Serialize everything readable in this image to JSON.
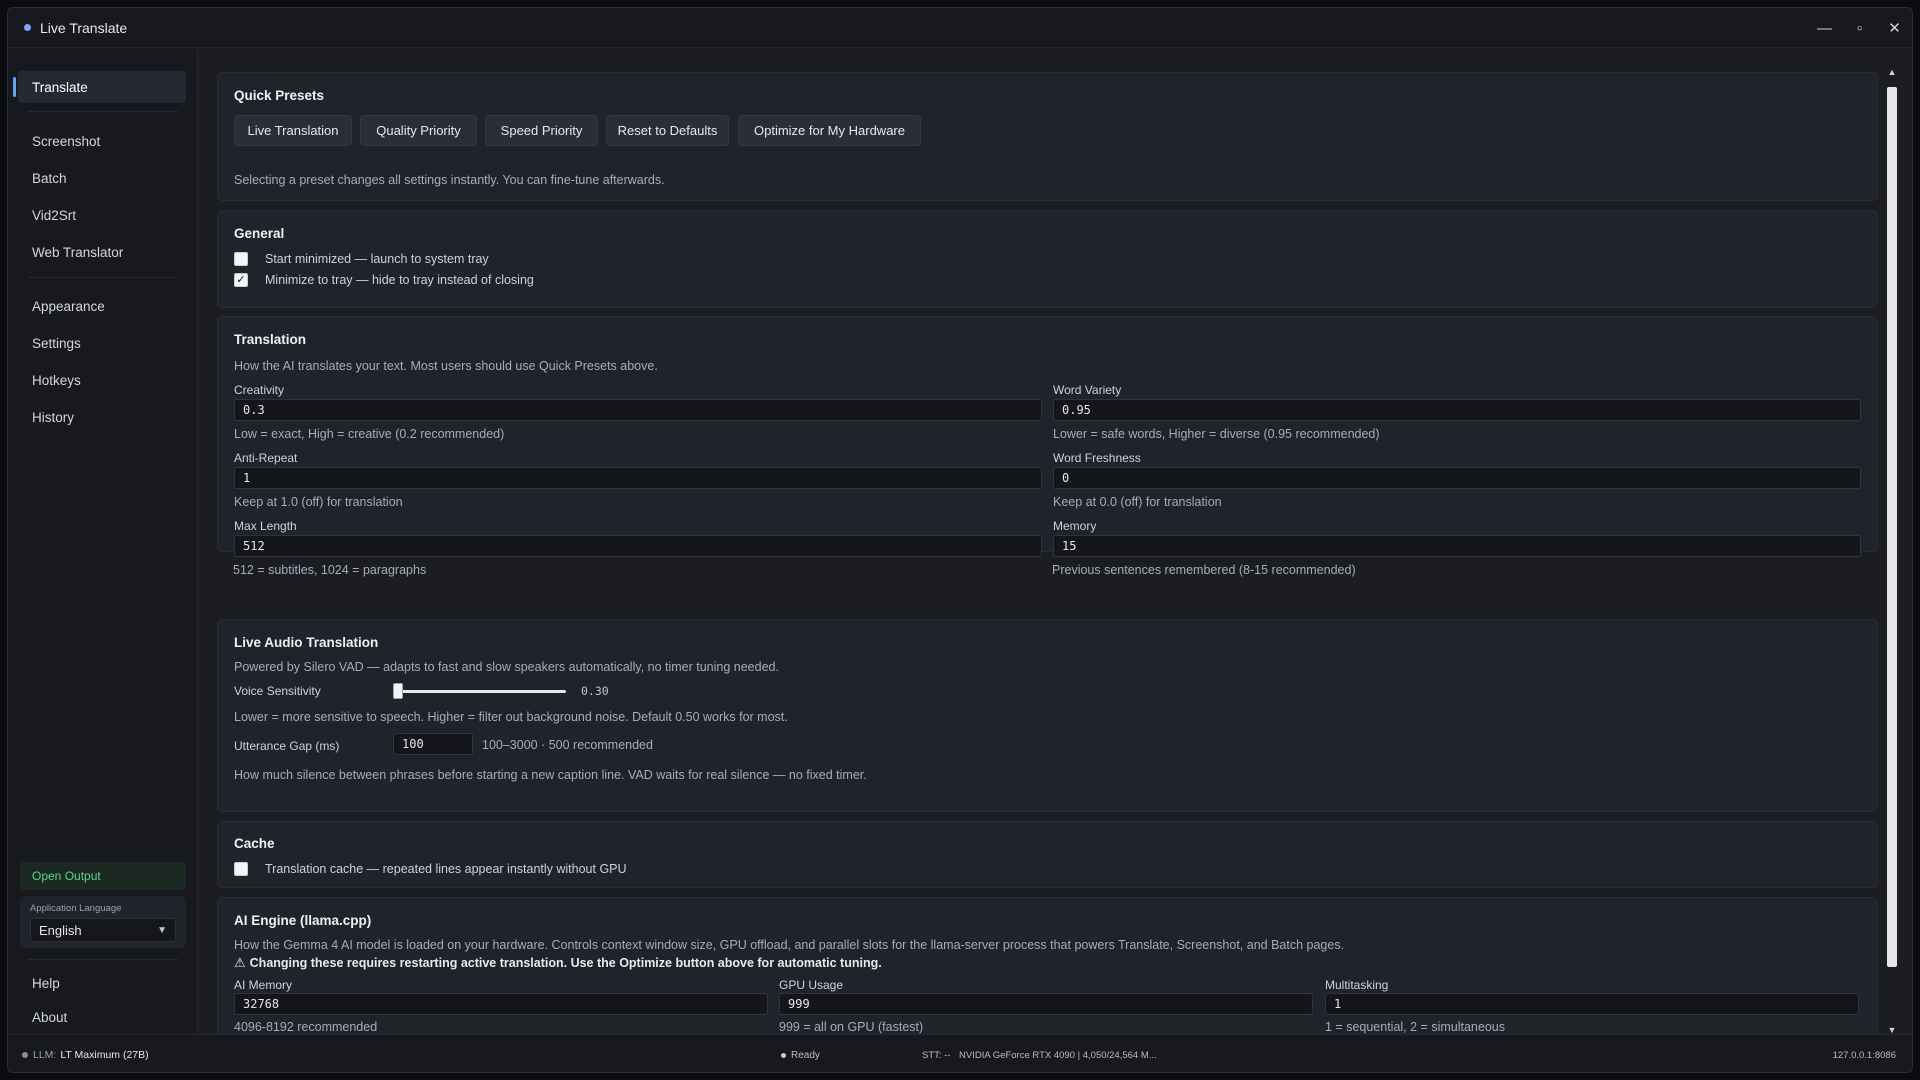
{
  "window": {
    "title": "Live Translate",
    "controls": {
      "minimize": "—",
      "maximize": "▫",
      "close": "✕"
    }
  },
  "sidebar": {
    "nav": [
      {
        "label": "Translate",
        "active": true
      },
      {
        "label": "Screenshot"
      },
      {
        "label": "Batch"
      },
      {
        "label": "Vid2Srt"
      },
      {
        "label": "Web Translator"
      },
      {
        "label": "Appearance"
      },
      {
        "label": "Settings"
      },
      {
        "label": "Hotkeys"
      },
      {
        "label": "History"
      }
    ],
    "open_output": "Open Output",
    "language_label": "Application Language",
    "language_value": "English",
    "help": "Help",
    "about": "About"
  },
  "presets": {
    "title": "Quick Presets",
    "buttons": [
      "Live Translation",
      "Quality Priority",
      "Speed Priority",
      "Reset to Defaults",
      "Optimize for My Hardware"
    ],
    "note": "Selecting a preset changes all settings instantly. You can fine-tune afterwards."
  },
  "general": {
    "title": "General",
    "start_minimized": {
      "label": "Start minimized — launch to system tray",
      "checked": false
    },
    "minimize_to_tray": {
      "label": "Minimize to tray — hide to tray instead of closing",
      "checked": true
    }
  },
  "translation": {
    "title": "Translation",
    "desc": "How the AI translates your text. Most users should use Quick Presets above.",
    "creativity": {
      "label": "Creativity",
      "value": "0.3",
      "hint": "Low = exact, High = creative (0.2 recommended)"
    },
    "word_variety": {
      "label": "Word Variety",
      "value": "0.95",
      "hint": "Lower = safe words, Higher = diverse (0.95 recommended)"
    },
    "anti_repeat": {
      "label": "Anti-Repeat",
      "value": "1",
      "hint": "Keep at 1.0 (off) for translation"
    },
    "word_freshness": {
      "label": "Word Freshness",
      "value": "0",
      "hint": "Keep at 0.0 (off) for translation"
    },
    "max_length": {
      "label": "Max Length",
      "value": "512",
      "hint": "512 = subtitles, 1024 = paragraphs"
    },
    "memory": {
      "label": "Memory",
      "value": "15",
      "hint": "Previous sentences remembered (8-15 recommended)"
    }
  },
  "audio": {
    "title": "Live Audio Translation",
    "desc": "Powered by Silero VAD — adapts to fast and slow speakers automatically, no timer tuning needed.",
    "voice_sensitivity": {
      "label": "Voice Sensitivity",
      "value": "0.30",
      "fraction": 0.3,
      "hint": "Lower = more sensitive to speech. Higher = filter out background noise. Default 0.50 works for most."
    },
    "utterance_gap": {
      "label": "Utterance Gap (ms)",
      "value": "100",
      "range": "100–3000 · 500 recommended",
      "hint": "How much silence between phrases before starting a new caption line. VAD waits for real silence — no fixed timer."
    }
  },
  "cache": {
    "title": "Cache",
    "translation_cache": {
      "label": "Translation cache — repeated lines appear instantly without GPU",
      "checked": false
    }
  },
  "ai_engine": {
    "title": "AI Engine (llama.cpp)",
    "desc": "How the Gemma 4 AI model is loaded on your hardware.  Controls context window size, GPU offload, and parallel slots for the llama-server process that powers Translate, Screenshot, and Batch pages.",
    "warning": "Changing these requires restarting active translation. Use the Optimize button above for automatic tuning.",
    "warning_icon": "warning-icon",
    "ai_memory": {
      "label": "AI Memory",
      "value": "32768",
      "hint": "4096-8192 recommended"
    },
    "gpu_usage": {
      "label": "GPU Usage",
      "value": "999",
      "hint": "999 = all on GPU (fastest)"
    },
    "multitasking": {
      "label": "Multitasking",
      "value": "1",
      "hint": "1 = sequential, 2 = simultaneous"
    }
  },
  "status": {
    "llm_label": "LLM:",
    "llm_value": "LT Maximum (27B)",
    "ready": "Ready",
    "stt": "STT: --",
    "gpu": "NVIDIA GeForce RTX 4090 | 4,050/24,564 M...",
    "address": "127.0.0.1:8086"
  }
}
